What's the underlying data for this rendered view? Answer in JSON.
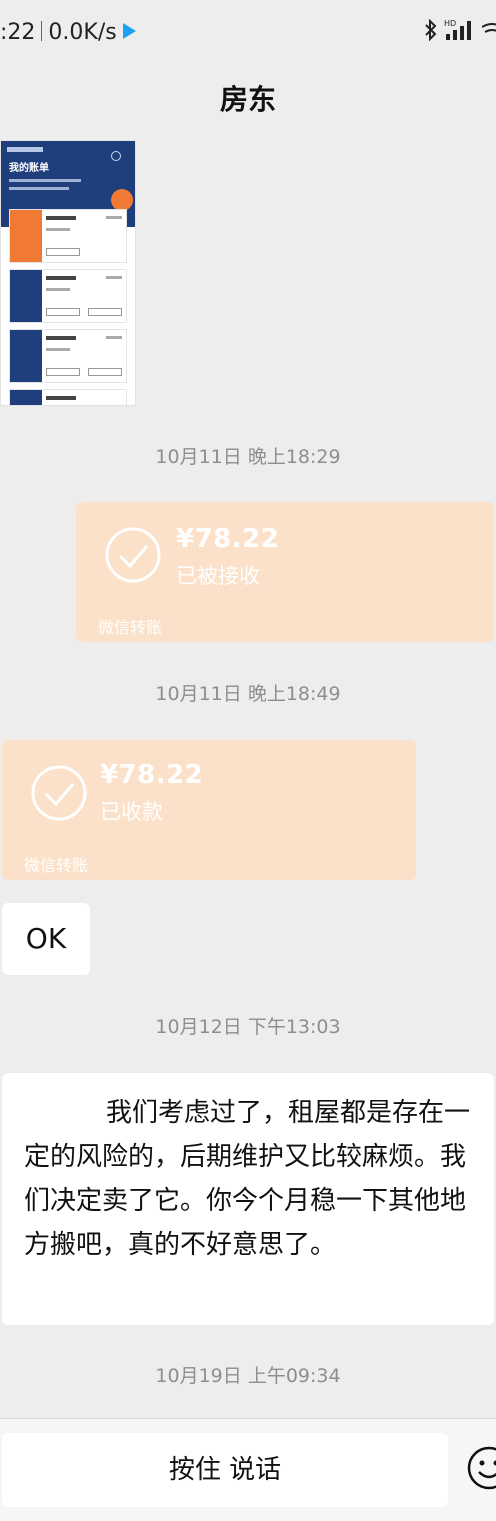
{
  "status": {
    "time": ":22",
    "speed": "0.0K/s",
    "hd": "HD"
  },
  "header": {
    "title": "房东"
  },
  "shared_image": {
    "heading": "我的账单"
  },
  "messages": [
    {
      "type": "timestamp",
      "text": "10月11日 晚上18:29"
    },
    {
      "type": "transfer",
      "side": "right",
      "amount": "¥78.22",
      "status": "已被接收",
      "label": "微信转账"
    },
    {
      "type": "timestamp",
      "text": "10月11日 晚上18:49"
    },
    {
      "type": "transfer",
      "side": "left",
      "amount": "¥78.22",
      "status": "已收款",
      "label": "微信转账"
    },
    {
      "type": "text",
      "side": "left",
      "text": "OK"
    },
    {
      "type": "timestamp",
      "text": "10月12日 下午13:03"
    },
    {
      "type": "text",
      "side": "left",
      "text": "我们考虑过了，租屋都是存在一定的风险的，后期维护又比较麻烦。我们决定卖了它。你今个月稳一下其他地方搬吧，真的不好意思了。"
    },
    {
      "type": "timestamp",
      "text": "10月19日 上午09:34"
    }
  ],
  "input_bar": {
    "voice_label": "按住 说话",
    "emoji_icon": "emoji-icon"
  },
  "colors": {
    "background": "#ededed",
    "transfer_received": "#fbe1c9",
    "bubble": "#ffffff",
    "timestamp": "#8e8e8e"
  }
}
